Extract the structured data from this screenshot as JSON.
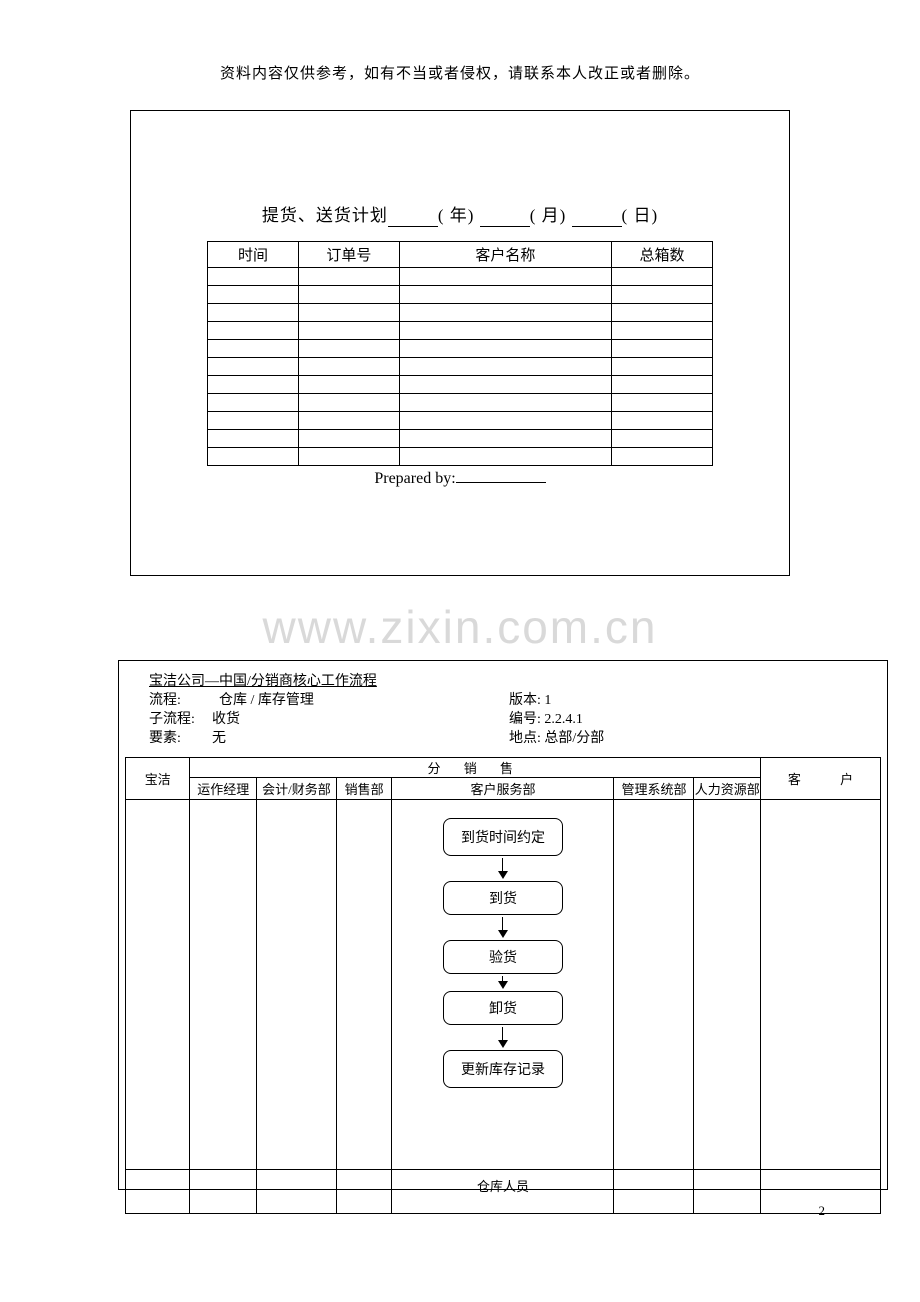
{
  "disclaimer": "资料内容仅供参考，如有不当或者侵权，请联系本人改正或者删除。",
  "pageNumber": "2",
  "watermark": "www.zixin.com.cn",
  "plan": {
    "title_prefix": "提货、送货计划",
    "year_label": "( 年)",
    "month_label": "( 月)",
    "day_label": "( 日)",
    "headers": {
      "time": "时间",
      "order": "订单号",
      "customer": "客户名称",
      "total": "总箱数"
    },
    "rowCount": 11,
    "prepared_by_label": "Prepared by:",
    "prepared_by_value": ""
  },
  "meta": {
    "title": "宝洁公司—中国/分销商核心工作流程",
    "labels": {
      "flow": "流程:",
      "subflow": "子流程:",
      "element": "要素:",
      "version": "版本:",
      "code": "编号:",
      "location": "地点:"
    },
    "flow": "仓库 / 库存管理",
    "subflow": "收货",
    "element": "无",
    "version": "1",
    "code": "2.2.4.1",
    "location": "总部/分部"
  },
  "flowtable": {
    "headers": {
      "baojie": "宝洁",
      "distribution": "分  销  售",
      "ops": "运作经理",
      "acct": "会计/财务部",
      "sales": "销售部",
      "csd": "客户服务部",
      "mis": "管理系统部",
      "hr": "人力资源部",
      "customer": "客  户"
    },
    "steps": [
      "到货时间约定",
      "到货",
      "验货",
      "卸货",
      "更新库存记录"
    ],
    "footer_csd": "仓库人员"
  }
}
